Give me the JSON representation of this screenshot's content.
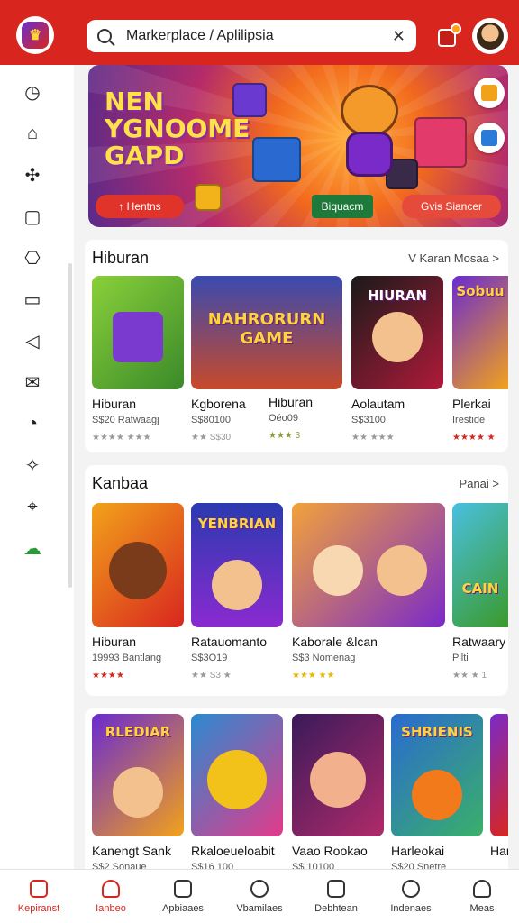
{
  "search": {
    "value": "Markerplace / Aplilipsia"
  },
  "banner": {
    "title": "NEN YGNOOME GAPD",
    "pill_left": "↑ Hentns",
    "pill_mid": "Biquacm",
    "pill_right": "Gvis Siancer"
  },
  "sections": [
    {
      "title": "Hiburan",
      "more": "V Karan Mosaa >",
      "cards": [
        {
          "thumb_label": "",
          "name": "Hiburan",
          "price": "S$20 Ratwaagj",
          "rating": "★★★★ ★★★"
        },
        {
          "thumb_label": "NAHRORURN GAME",
          "name": "Kgborena",
          "price": "S$80100",
          "rating": "★★ S$30"
        },
        {
          "thumb_label": "",
          "name": "Hiburan",
          "price": "Oéo09",
          "rating": "★★★ 3"
        },
        {
          "thumb_label": "HIURAN",
          "name": "Aolautam",
          "price": "S$3100",
          "rating": "★★ ★★★"
        },
        {
          "thumb_label": "Sobuu",
          "name": "Plerkai",
          "price": "Irestide",
          "rating": "★★★★ ★"
        }
      ]
    },
    {
      "title": "Kanbaa",
      "more": "Panai >",
      "cards": [
        {
          "thumb_label": "",
          "name": "Hiburan",
          "price": "19993 Bantlang",
          "rating": "★★★★"
        },
        {
          "thumb_label": "YENBRIAN",
          "name": "Ratauomanto",
          "price": "S$3O19",
          "rating": "★★ S3 ★"
        },
        {
          "thumb_label": "",
          "name": "Kaborale &lcan",
          "price": "S$3 Nomenag",
          "rating": "★★★ ★★"
        },
        {
          "thumb_label": "CAIN",
          "name": "Ratwaary",
          "price": "Pilti",
          "rating": "★★ ★ 1"
        }
      ]
    },
    {
      "title": "",
      "more": "",
      "cards": [
        {
          "thumb_label": "RLEDIAR",
          "name": "Kanengt Sank",
          "price": "S$2 Sonaue",
          "rating": ""
        },
        {
          "thumb_label": "",
          "name": "Rkaloeueloabit",
          "price": "S$16 100",
          "rating": ""
        },
        {
          "thumb_label": "",
          "name": "Vaao Rookao",
          "price": "S$ 10100",
          "rating": ""
        },
        {
          "thumb_label": "SHRIENIS",
          "name": "Harleokai",
          "price": "S$20 Snetre",
          "rating": ""
        },
        {
          "thumb_label": "",
          "name": "Har",
          "price": "",
          "rating": ""
        }
      ]
    }
  ],
  "nav": [
    {
      "label": "Kepiranst",
      "active": true
    },
    {
      "label": "Ianbeo",
      "active": false
    },
    {
      "label": "Apbiaaes",
      "active": false
    },
    {
      "label": "Vbamilaes",
      "active": false
    },
    {
      "label": "Debhtean",
      "active": false
    },
    {
      "label": "Indenaes",
      "active": false
    },
    {
      "label": "Meas",
      "active": false
    }
  ],
  "colors": {
    "brand": "#d8261f",
    "rating_red": "#d8261f",
    "rating_grey": "#999999",
    "rating_gold": "#e6b800"
  }
}
